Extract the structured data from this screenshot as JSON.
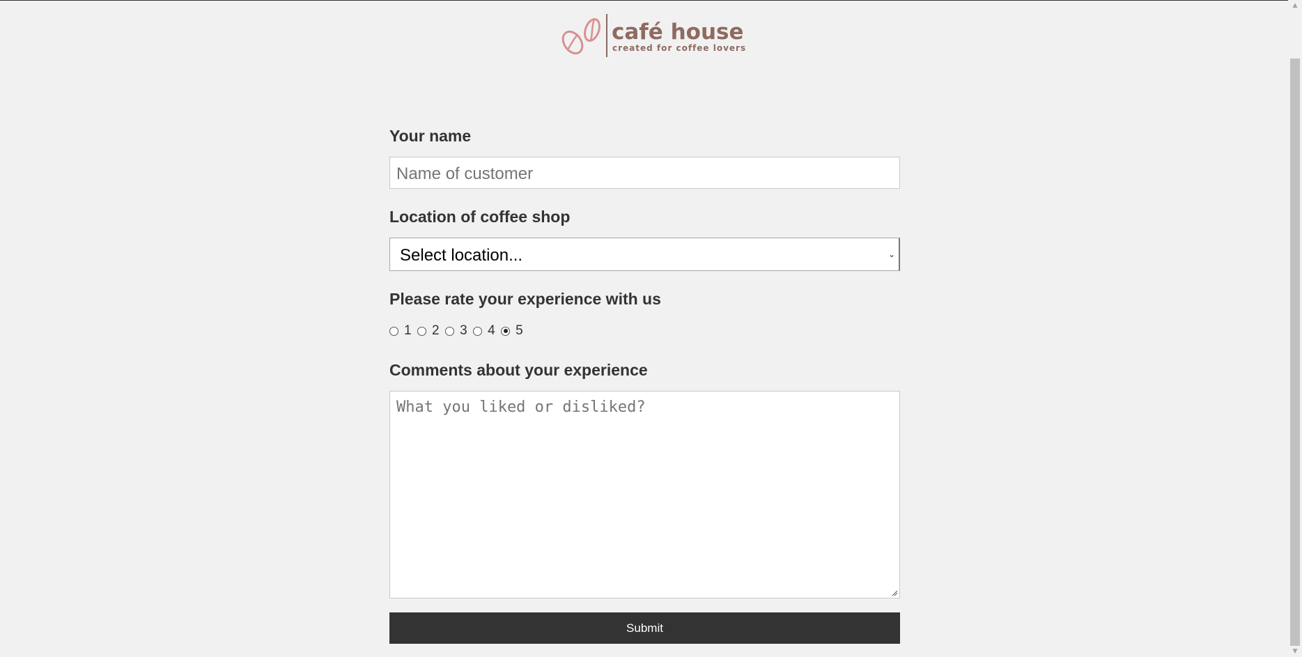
{
  "brand": {
    "name": "café house",
    "tagline": "created for coffee lovers",
    "logo_icon": "coffee-beans-icon",
    "color": "#8f6a60",
    "bean_color": "#d9908f"
  },
  "form": {
    "name_label": "Your name",
    "name_placeholder": "Name of customer",
    "location_label": "Location of coffee shop",
    "location_selected": "Select location...",
    "rating_label": "Please rate your experience with us",
    "rating_options": [
      "1",
      "2",
      "3",
      "4",
      "5"
    ],
    "rating_selected": "5",
    "comments_label": "Comments about your experience",
    "comments_placeholder": "What you liked or disliked?",
    "submit_label": "Submit",
    "submit_color": "#333333"
  }
}
